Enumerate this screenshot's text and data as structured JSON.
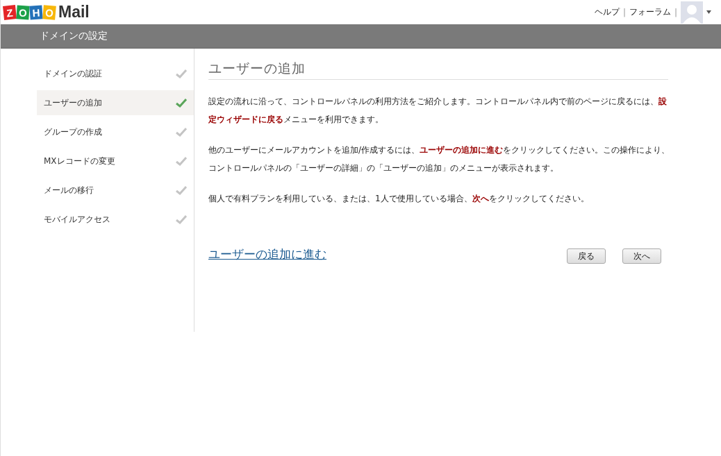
{
  "logo": {
    "letters": [
      "Z",
      "O",
      "H",
      "O"
    ],
    "product": "Mail"
  },
  "top_links": [
    "ヘルプ",
    "フォーラム"
  ],
  "top_separator": "|",
  "header": {
    "title": "ドメインの設定"
  },
  "sidebar": {
    "items": [
      {
        "label": "ドメインの認証",
        "selected": false
      },
      {
        "label": "ユーザーの追加",
        "selected": true
      },
      {
        "label": "グループの作成",
        "selected": false
      },
      {
        "label": "MXレコードの変更",
        "selected": false
      },
      {
        "label": "メールの移行",
        "selected": false
      },
      {
        "label": "モバイルアクセス",
        "selected": false
      }
    ]
  },
  "content": {
    "title": "ユーザーの追加",
    "paragraphs": [
      "設定の流れに沿って、コントロールパネルの利用方法をご紹介します。コントロールパネル内で前のページに戻るには、**設定ウィザードに戻る**メニューを利用できます。",
      "他のユーザーにメールアカウントを追加/作成するには、**ユーザーの追加に進む**をクリックしてください。この操作により、コントロールパネルの「ユーザーの詳細」の「ユーザーの追加」のメニューが表示されます。",
      "個人で有料プランを利用している、または、1人で使用している場合、**次へ**をクリックしてください。"
    ],
    "link": "ユーザーの追加に進む",
    "buttons": [
      "戻る",
      "次へ"
    ]
  }
}
